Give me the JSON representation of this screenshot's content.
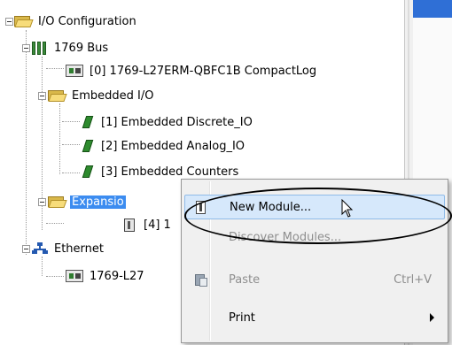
{
  "tree": {
    "io_configuration": "I/O Configuration",
    "bus": "1769 Bus",
    "controller": "[0] 1769-L27ERM-QBFC1B CompactLog",
    "embedded_io": "Embedded I/O",
    "embedded_items": [
      "[1] Embedded Discrete_IO",
      "[2] Embedded Analog_IO",
      "[3] Embedded Counters"
    ],
    "expansion": "Expansio",
    "expansion_child": "[4] 1",
    "ethernet": "Ethernet",
    "ethernet_child": "1769-L27"
  },
  "context_menu": {
    "items": [
      {
        "label": "New Module...",
        "icon": "new-module-icon",
        "state": "highlighted"
      },
      {
        "label": "Discover Modules...",
        "state": "disabled"
      },
      {
        "label": "Paste",
        "shortcut": "Ctrl+V",
        "icon": "paste-icon",
        "state": "disabled"
      },
      {
        "label": "Print",
        "submenu": true
      }
    ]
  },
  "colors": {
    "selection": "#3c8cf0",
    "menu_background": "#f0f0f0",
    "menu_highlight": "#d6e8fb"
  }
}
